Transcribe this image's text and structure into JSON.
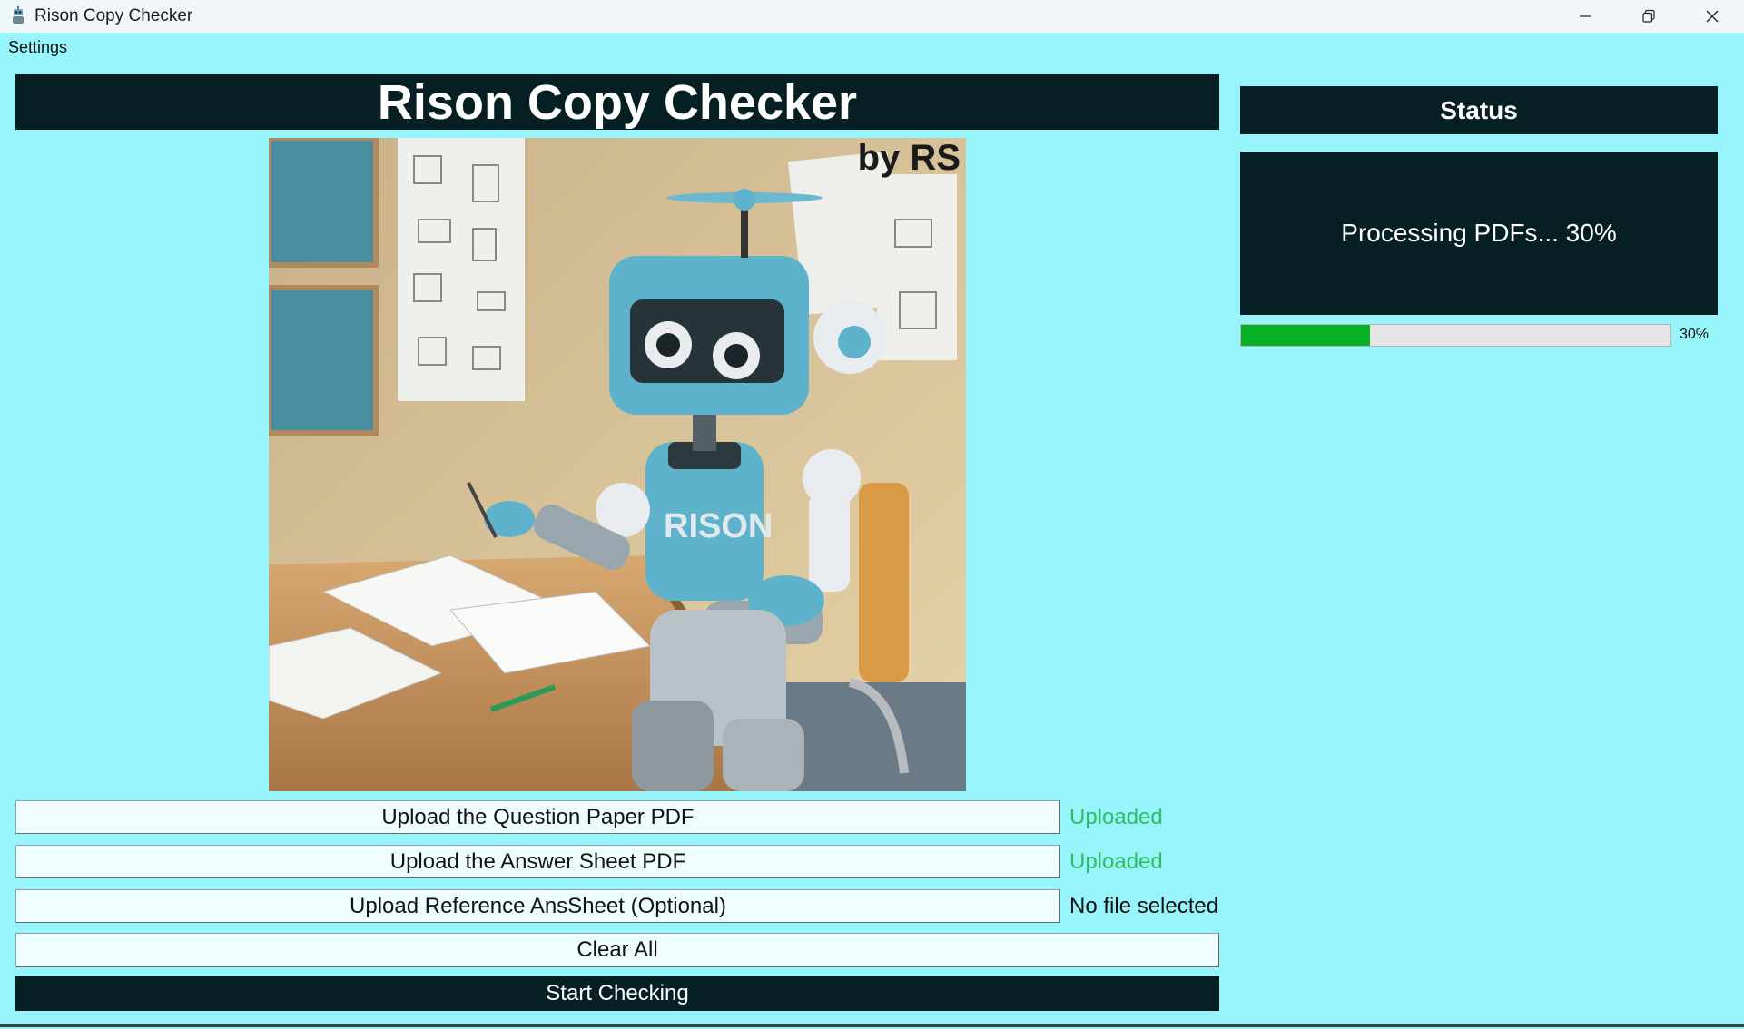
{
  "window": {
    "title": "Rison Copy Checker",
    "icon": "app-robot-icon",
    "controls": [
      "minimize-icon",
      "restore-icon",
      "close-icon"
    ]
  },
  "menu": {
    "items": [
      "Settings"
    ]
  },
  "main": {
    "heading": "Rison Copy Checker",
    "image": {
      "overlay_text": "by RS",
      "robot_chest_text": "RISON"
    },
    "uploads": [
      {
        "label": "Upload the Question Paper PDF",
        "status": "Uploaded",
        "status_color": "#2dbe63"
      },
      {
        "label": "Upload the Answer Sheet PDF",
        "status": "Uploaded",
        "status_color": "#2dbe63"
      },
      {
        "label": "Upload Reference AnsSheet (Optional)",
        "status": "No file selected",
        "status_color": "#111111"
      }
    ],
    "clear_label": "Clear All",
    "start_label": "Start Checking"
  },
  "status_panel": {
    "header": "Status",
    "message": "Processing PDFs... 30%",
    "progress": 0.3,
    "progress_label": "30%",
    "progress_color": "#06b025"
  },
  "colors": {
    "background": "#97f4fa",
    "dark": "#061f23",
    "button_bg": "#eefeff"
  }
}
